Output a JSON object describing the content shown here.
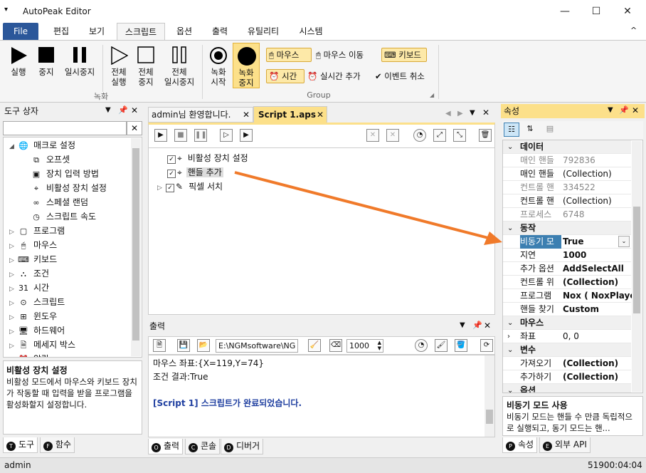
{
  "window": {
    "title": "AutoPeak Editor",
    "minimize": "—",
    "maximize": "☐",
    "close": "✕",
    "quick_access": "▾"
  },
  "menu": {
    "items": [
      "File",
      "편집",
      "보기",
      "스크립트",
      "옵션",
      "출력",
      "유틸리티",
      "시스템"
    ],
    "collapse": "^"
  },
  "ribbon": {
    "record_group_label": "녹화",
    "group_label": "Group",
    "buttons": {
      "run": "실행",
      "stop": "중지",
      "pause": "일시중지",
      "all_run": "전체\n실행",
      "all_stop": "전체\n중지",
      "all_pause": "전체\n일시중지",
      "rec_start": "녹화\n시작",
      "rec_stop": "녹화\n중지"
    },
    "opts": {
      "mouse": "마우스",
      "mouse_move": "마우스 이동",
      "keyboard": "키보드",
      "time": "시간",
      "realtime_add": "실시간 추가",
      "event_cancel": "이벤트 취소"
    }
  },
  "toolbox": {
    "title": "도구 상자",
    "tree": [
      {
        "label": "매크로 설정",
        "level": 0,
        "expanded": true,
        "icon": "globe-icon"
      },
      {
        "label": "오프셋",
        "level": 1,
        "icon": "offset-icon"
      },
      {
        "label": "장치 입력 방법",
        "level": 1,
        "icon": "device-input-icon"
      },
      {
        "label": "비활성 장치 설정",
        "level": 1,
        "icon": "crosshair-icon"
      },
      {
        "label": "스페셜 랜덤",
        "level": 1,
        "icon": "infinity-icon"
      },
      {
        "label": "스크립트 속도",
        "level": 1,
        "icon": "speed-icon"
      },
      {
        "label": "프로그램",
        "level": 0,
        "icon": "program-icon"
      },
      {
        "label": "마우스",
        "level": 0,
        "icon": "mouse-icon"
      },
      {
        "label": "키보드",
        "level": 0,
        "icon": "keyboard-icon"
      },
      {
        "label": "조건",
        "level": 0,
        "icon": "condition-icon"
      },
      {
        "label": "시간",
        "level": 0,
        "icon": "calendar-icon"
      },
      {
        "label": "스크립트",
        "level": 0,
        "icon": "script-icon"
      },
      {
        "label": "윈도우",
        "level": 0,
        "icon": "windows-icon"
      },
      {
        "label": "하드웨어",
        "level": 0,
        "icon": "hardware-icon"
      },
      {
        "label": "메세지 박스",
        "level": 0,
        "icon": "message-icon"
      },
      {
        "label": "알람",
        "level": 0,
        "icon": "alarm-icon"
      }
    ],
    "desc_title": "비활성 장치 설정",
    "desc_text": "비활성 모드에서 마우스와 키보드 장치가 작동할 때 입력을 받을 프로그램을 활성화할지 설정합니다.",
    "tabs": [
      "도구",
      "함수"
    ]
  },
  "editor": {
    "tabs": [
      "admin님 환영합니다.",
      "Script 1.aps"
    ],
    "tree": [
      {
        "label": "비활성 장치 설정",
        "icon": "crosshair-icon"
      },
      {
        "label": "핸들 추가",
        "icon": "crosshair-icon"
      },
      {
        "label": "픽셀 서치",
        "icon": "eyedropper-icon"
      }
    ]
  },
  "output": {
    "title": "출력",
    "path": "E:\\NGMsoftware\\NG",
    "delay": "1000",
    "lines": [
      "마우스 좌표:{X=119,Y=74}",
      "조건 결과:True",
      "",
      "[Script 1] 스크립트가 완료되었습니다."
    ],
    "tabs": [
      "출력",
      "콘솔",
      "디버거"
    ]
  },
  "properties": {
    "title": "속성",
    "rows": [
      {
        "type": "cat",
        "k": "데이터"
      },
      {
        "k": "매인 핸들",
        "v": "792836",
        "gray": true
      },
      {
        "k": "매인 핸들",
        "v": "(Collection)"
      },
      {
        "k": "컨트롤 핸",
        "v": "334522",
        "gray": true
      },
      {
        "k": "컨트롤 핸",
        "v": "(Collection)"
      },
      {
        "k": "프로세스",
        "v": "6748",
        "gray": true
      },
      {
        "type": "cat",
        "k": "동작"
      },
      {
        "k": "비동기 모",
        "v": "True",
        "bold": true,
        "selected": true
      },
      {
        "k": "지연",
        "v": "1000",
        "bold": true
      },
      {
        "k": "추가 옵션",
        "v": "AddSelectAll",
        "bold": true
      },
      {
        "k": "컨트롤 위",
        "v": "(Collection)",
        "bold": true
      },
      {
        "k": "프로그램",
        "v": "Nox ( NoxPlayer",
        "bold": true
      },
      {
        "k": "핸들 찾기",
        "v": "Custom",
        "bold": true
      },
      {
        "type": "cat",
        "k": "마우스"
      },
      {
        "k": "좌표",
        "v": "0, 0",
        "expander": true
      },
      {
        "type": "cat",
        "k": "변수"
      },
      {
        "k": "가져오기",
        "v": "(Collection)",
        "bold": true
      },
      {
        "k": "추가하기",
        "v": "(Collection)",
        "bold": true
      },
      {
        "type": "cat",
        "k": "옵션"
      }
    ],
    "desc_title": "비동기 모드 사용",
    "desc_text": "비동기 모드는 핸들 수 만큼 독립적으로 실행되고, 동기 모드는 핸...",
    "tabs": [
      "속성",
      "외부 API"
    ]
  },
  "status": {
    "user": "admin",
    "right": "51900:04:04"
  },
  "colors": {
    "accent": "#2b579a",
    "arrow": "#f07a2a",
    "highlight": "#fce08a"
  }
}
